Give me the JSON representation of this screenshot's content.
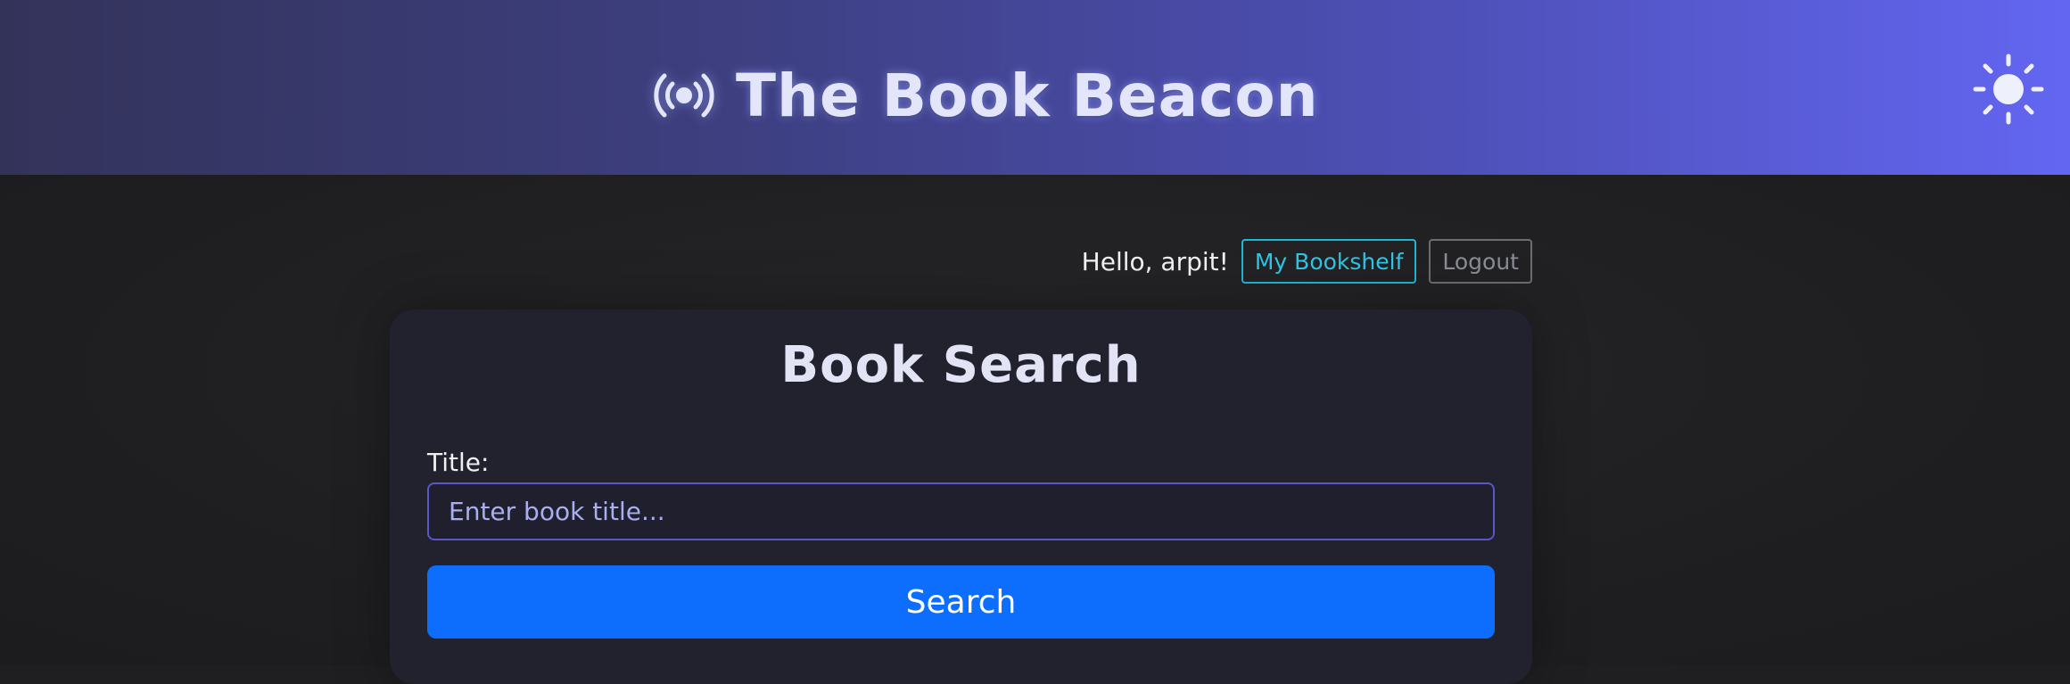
{
  "header": {
    "app_title": "The Book Beacon",
    "brand_icon": "broadcast-beacon-icon",
    "theme_toggle_icon": "sun-icon",
    "background_start": "#33335a",
    "background_end": "#6366f1"
  },
  "user_bar": {
    "greeting": "Hello, arpit!",
    "bookshelf_label": "My Bookshelf",
    "logout_label": "Logout",
    "bookshelf_color": "#2ec6e6"
  },
  "search_card": {
    "heading": "Book Search",
    "title_label": "Title:",
    "title_input": {
      "value": "",
      "placeholder": "Enter book title..."
    },
    "search_button_label": "Search",
    "search_button_color": "#0d6efd"
  }
}
